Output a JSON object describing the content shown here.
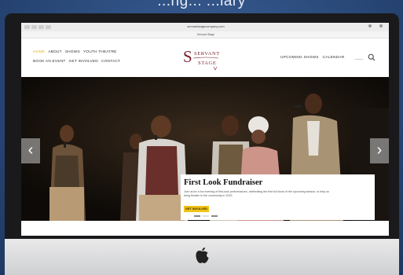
{
  "caption": {
    "text": "...ng... ...lary"
  },
  "browser": {
    "url": "servantstagecompany.com",
    "tab_title": "Servant Stage"
  },
  "nav": {
    "row1": [
      {
        "label": "HOME",
        "active": true
      },
      {
        "label": "ABOUT",
        "active": false
      },
      {
        "label": "SHOWS",
        "active": false
      },
      {
        "label": "YOUTH THEATRE",
        "active": false
      }
    ],
    "row2": [
      {
        "label": "BOOK AN EVENT"
      },
      {
        "label": "GET INVOLVED"
      },
      {
        "label": "CONTACT"
      }
    ],
    "right": [
      {
        "label": "UPCOMING SHOWS"
      },
      {
        "label": "CALENDAR"
      }
    ]
  },
  "logo": {
    "line1": "SERVANT",
    "line2": "STAGE"
  },
  "slide": {
    "title": "First Look Fundraiser",
    "text": "Join us for a fun evening of first-look performances, celebrating the first full show of the upcoming season, to help us bring theater to the community in 2020.",
    "button": "GET INVOLVED"
  },
  "slider": {
    "active_index": 1,
    "count": 3
  },
  "colors": {
    "accent": "#e2b514",
    "logo": "#7a1f2b",
    "button": "#f0c419"
  }
}
